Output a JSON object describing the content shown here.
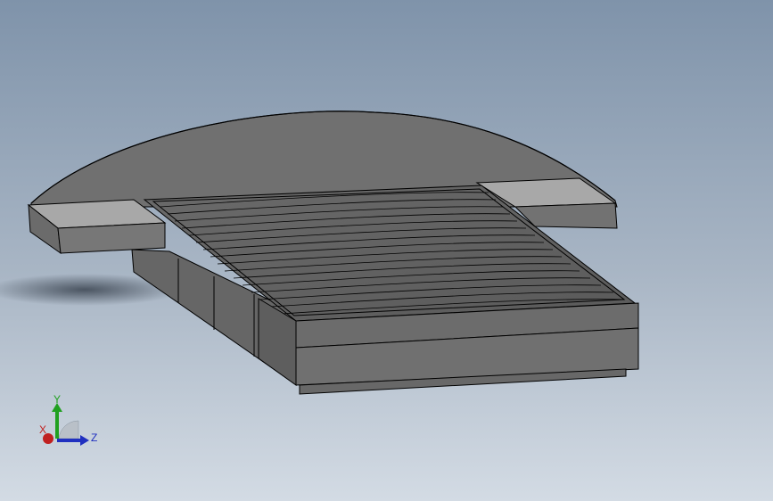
{
  "viewport": {
    "background_top": "#7f93aa",
    "background_bottom": "#d3dbe4"
  },
  "model": {
    "body_color": "#6e6e6e",
    "light_face_color": "#a7a7a7",
    "edge_color": "#000000"
  },
  "triad": {
    "x_label": "X",
    "y_label": "Y",
    "z_label": "Z",
    "x_color": "#c02020",
    "y_color": "#20a020",
    "z_color": "#2030c0"
  }
}
